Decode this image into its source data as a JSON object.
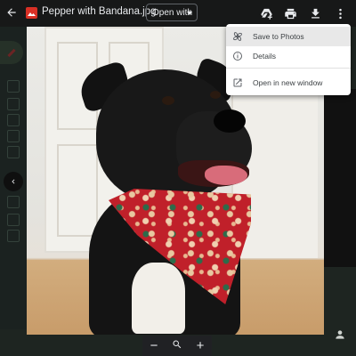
{
  "topbar": {
    "file_name": "Pepper with Bandana.jpg",
    "open_with_label": "Open with"
  },
  "icons": {
    "back": "arrow-back-icon",
    "file_type": "image-file-icon",
    "add_to_drive": "add-to-drive-icon",
    "print": "print-icon",
    "download": "download-icon",
    "more": "more-vert-icon"
  },
  "menu": {
    "items": [
      {
        "label": "Save to Photos",
        "icon": "photos-icon"
      },
      {
        "label": "Details",
        "icon": "info-icon"
      },
      {
        "label": "Open in new window",
        "icon": "open-in-new-icon"
      }
    ]
  },
  "zoom": {
    "minus": "−",
    "plus": "+"
  },
  "colors": {
    "accent_red": "#d93025",
    "toolbar_bg": "#171818",
    "menu_hover": "#e8e8e8"
  }
}
